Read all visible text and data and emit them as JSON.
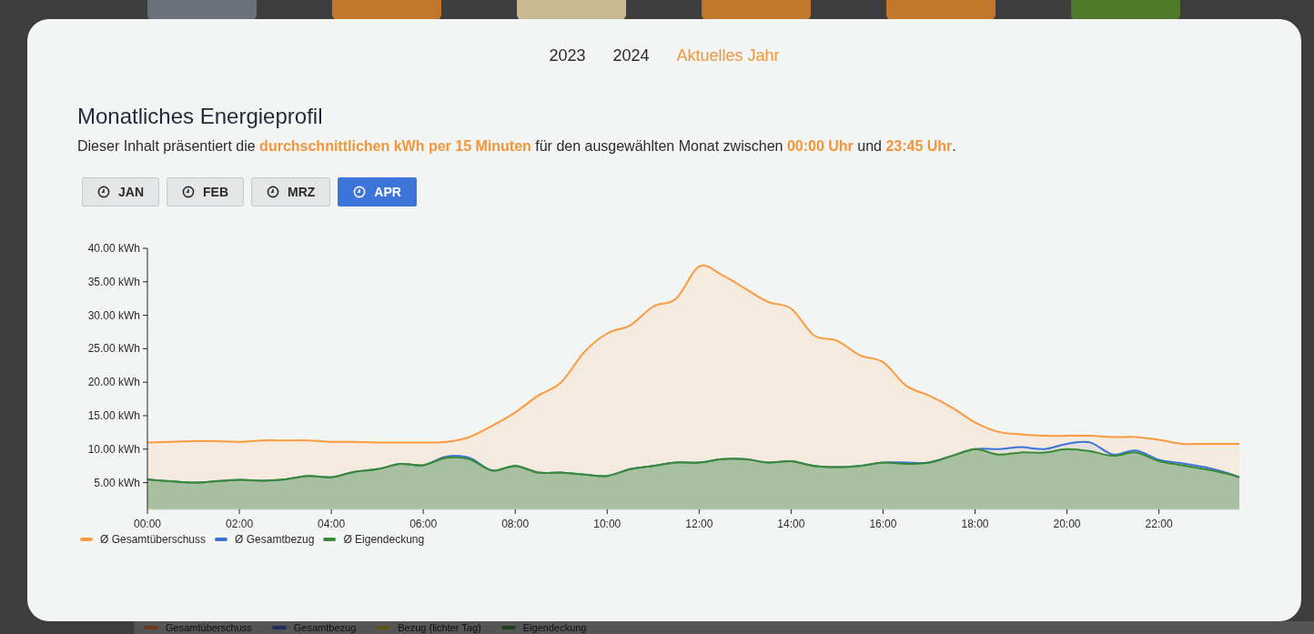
{
  "background": {
    "category_icons": [
      {
        "color": "#6b717a"
      },
      {
        "color": "#c2782a"
      },
      {
        "color": "#c9b98f"
      },
      {
        "color": "#c2782a"
      },
      {
        "color": "#c2782a"
      },
      {
        "color": "#4f7a2a"
      }
    ],
    "legend": [
      {
        "label": "Gesamtüberschuss",
        "color": "#6b3a1c"
      },
      {
        "label": "Gesamtbezug",
        "color": "#1c2f5a"
      },
      {
        "label": "Bezug (lichter Tag)",
        "color": "#5e5418"
      },
      {
        "label": "Eigendeckung",
        "color": "#1e3d1a"
      }
    ]
  },
  "dialog": {
    "year_tabs": [
      {
        "label": "2023",
        "selected": false
      },
      {
        "label": "2024",
        "selected": false
      },
      {
        "label": "Aktuelles Jahr",
        "selected": true
      }
    ],
    "title": "Monatliches Energieprofil",
    "description": "Dieser Inhalt präsentiert die **durchschnittlichen kWh per 15 Minuten** für den ausgewählten Monat zwischen **00:00 Uhr** und **23:45 Uhr**.",
    "months": [
      {
        "label": "JAN",
        "selected": false
      },
      {
        "label": "FEB",
        "selected": false
      },
      {
        "label": "MRZ",
        "selected": false
      },
      {
        "label": "APR",
        "selected": true
      }
    ],
    "chart_data": {
      "type": "area",
      "ylim": [
        1,
        40
      ],
      "xlim": [
        0,
        23.75
      ],
      "legend": "bottom",
      "yticks": [
        {
          "value": 5,
          "label": "5.00 kWh"
        },
        {
          "value": 10,
          "label": "10.00 kWh"
        },
        {
          "value": 15,
          "label": "15.00 kWh"
        },
        {
          "value": 20,
          "label": "20.00 kWh"
        },
        {
          "value": 25,
          "label": "25.00 kWh"
        },
        {
          "value": 30,
          "label": "30.00 kWh"
        },
        {
          "value": 35,
          "label": "35.00 kWh"
        },
        {
          "value": 40,
          "label": "40.00 kWh"
        }
      ],
      "xticks": [
        {
          "value": 0,
          "label": "00:00"
        },
        {
          "value": 2,
          "label": "02:00"
        },
        {
          "value": 4,
          "label": "04:00"
        },
        {
          "value": 6,
          "label": "06:00"
        },
        {
          "value": 8,
          "label": "08:00"
        },
        {
          "value": 10,
          "label": "10:00"
        },
        {
          "value": 12,
          "label": "12:00"
        },
        {
          "value": 14,
          "label": "14:00"
        },
        {
          "value": 16,
          "label": "16:00"
        },
        {
          "value": 18,
          "label": "18:00"
        },
        {
          "value": 20,
          "label": "20:00"
        },
        {
          "value": 22,
          "label": "22:00"
        }
      ],
      "x": [
        0,
        0.5,
        1,
        1.5,
        2,
        2.5,
        3,
        3.5,
        4,
        4.5,
        5,
        5.5,
        6,
        6.5,
        7,
        7.5,
        8,
        8.5,
        9,
        9.5,
        10,
        10.5,
        11,
        11.5,
        12,
        12.5,
        13,
        13.5,
        14,
        14.5,
        15,
        15.5,
        16,
        16.5,
        17,
        17.5,
        18,
        18.5,
        19,
        19.5,
        20,
        20.5,
        21,
        21.5,
        22,
        22.5,
        23,
        23.5,
        23.75
      ],
      "series": [
        {
          "name": "Ø Gesamtüberschuss",
          "color": "#fb9a3e",
          "values": [
            11,
            11.1,
            11.2,
            11.2,
            11.1,
            11.3,
            11.3,
            11.3,
            11.1,
            11.1,
            11,
            11,
            11,
            11.1,
            11.8,
            13.5,
            15.5,
            18,
            20,
            24.5,
            27.3,
            28.5,
            31.3,
            32.5,
            37.3,
            36,
            34,
            32,
            31,
            27,
            26.2,
            24,
            23,
            19.5,
            18,
            16.2,
            14,
            12.6,
            12.2,
            12,
            12,
            12,
            11.8,
            11.8,
            11.4,
            10.8,
            10.8,
            10.8,
            10.8
          ]
        },
        {
          "name": "Ø Gesamtbezug",
          "color": "#3b74d9",
          "values": [
            5.5,
            5.2,
            5,
            5.2,
            5.4,
            5.3,
            5.5,
            6,
            5.8,
            6.6,
            7,
            7.8,
            7.6,
            8.9,
            8.7,
            6.8,
            7.5,
            6.5,
            6.5,
            6.2,
            6,
            7,
            7.5,
            8,
            8,
            8.5,
            8.5,
            8,
            8.2,
            7.5,
            7.3,
            7.5,
            8,
            8,
            8,
            9,
            10,
            10,
            10.3,
            10,
            10.8,
            11,
            9.2,
            9.8,
            8.4,
            7.9,
            7.3,
            6.4,
            5.8
          ]
        },
        {
          "name": "Ø Eigendeckung",
          "color": "#3a8a35",
          "values": [
            5.5,
            5.2,
            5,
            5.2,
            5.4,
            5.3,
            5.5,
            6,
            5.8,
            6.6,
            7,
            7.8,
            7.6,
            8.7,
            8.5,
            6.8,
            7.5,
            6.5,
            6.5,
            6.2,
            6,
            7,
            7.5,
            8,
            8,
            8.5,
            8.5,
            8,
            8.2,
            7.5,
            7.3,
            7.5,
            8,
            7.8,
            8,
            9,
            10,
            9.2,
            9.5,
            9.5,
            10,
            9.7,
            9,
            9.5,
            8.2,
            7.6,
            7,
            6.3,
            5.8
          ]
        }
      ]
    }
  }
}
